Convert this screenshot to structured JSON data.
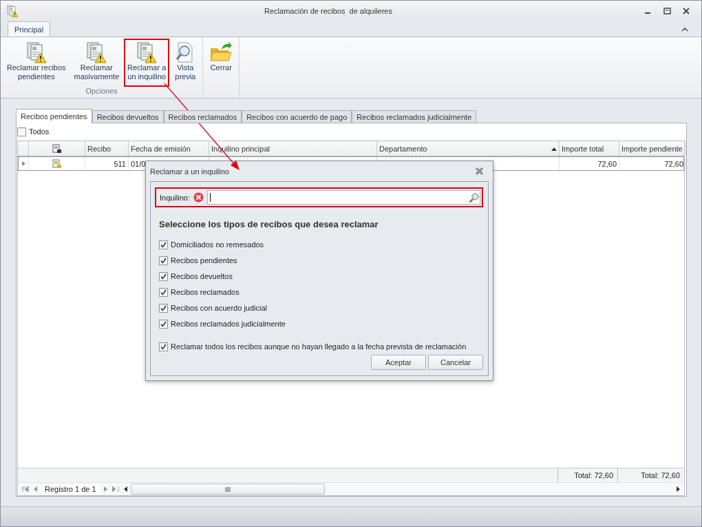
{
  "window": {
    "title": "Reclamación de recibos  de alquileres"
  },
  "ribbon": {
    "tabs": [
      {
        "label": "Principal",
        "selected": true
      }
    ],
    "groups": [
      {
        "label": "Opciones",
        "buttons": [
          {
            "label": "Reclamar recibos\npendientes",
            "highlighted": false
          },
          {
            "label": "Reclamar\nmasivamente",
            "highlighted": false
          },
          {
            "label": "Reclamar a\nun inquilino",
            "highlighted": true
          },
          {
            "label": "Vista\nprevia",
            "highlighted": false
          }
        ]
      },
      {
        "buttons": [
          {
            "label": "Cerrar",
            "highlighted": false
          }
        ]
      }
    ]
  },
  "tabs": [
    {
      "label": "Recibos pendientes",
      "selected": true
    },
    {
      "label": "Recibos devueltos",
      "selected": false
    },
    {
      "label": "Recibos reclamados",
      "selected": false
    },
    {
      "label": "Recibos con acuerdo de pago",
      "selected": false
    },
    {
      "label": "Recibos reclamados judicialmente",
      "selected": false
    }
  ],
  "select_all": {
    "label": "Todos",
    "checked": false
  },
  "grid": {
    "columns": [
      {
        "kind": "icon"
      },
      {
        "kind": "text",
        "label": "Recibo"
      },
      {
        "kind": "text",
        "label": "Fecha de emisión"
      },
      {
        "kind": "text",
        "label": "Inquilino principal"
      },
      {
        "kind": "text",
        "label": "Departamento",
        "sorted": true
      },
      {
        "kind": "text",
        "label": "Importe total"
      },
      {
        "kind": "text",
        "label": "Importe pendiente"
      }
    ],
    "rows": [
      {
        "selected": true,
        "recibo": "511",
        "fecha": "01/0",
        "importe_total": "72,60",
        "importe_pendiente": "72,60"
      }
    ],
    "totals": [
      "Total: 72,60",
      "Total: 72,60"
    ],
    "navigator": "Registro 1 de 1"
  },
  "dialog": {
    "title": "Reclamar a un inquilino",
    "inquilino_label": "Inquilino:",
    "inquilino_highlighted": true,
    "heading": "Seleccione los tipos de recibos que desea reclamar",
    "options": [
      {
        "label": "Domiciliados no remesados",
        "checked": true
      },
      {
        "label": "Recibos pendientes",
        "checked": true
      },
      {
        "label": "Recibos devueltos",
        "checked": true
      },
      {
        "label": "Recibos reclamados",
        "checked": true
      },
      {
        "label": "Recibos con acuerdo judicial",
        "checked": true
      },
      {
        "label": "Recibos reclamados judicialmente",
        "checked": true
      }
    ],
    "extra_option": {
      "label": "Reclamar todos los recibos aunque no hayan llegado a la fecha prevista de reclamación",
      "checked": true
    },
    "buttons": [
      "Aceptar",
      "Cancelar"
    ]
  }
}
